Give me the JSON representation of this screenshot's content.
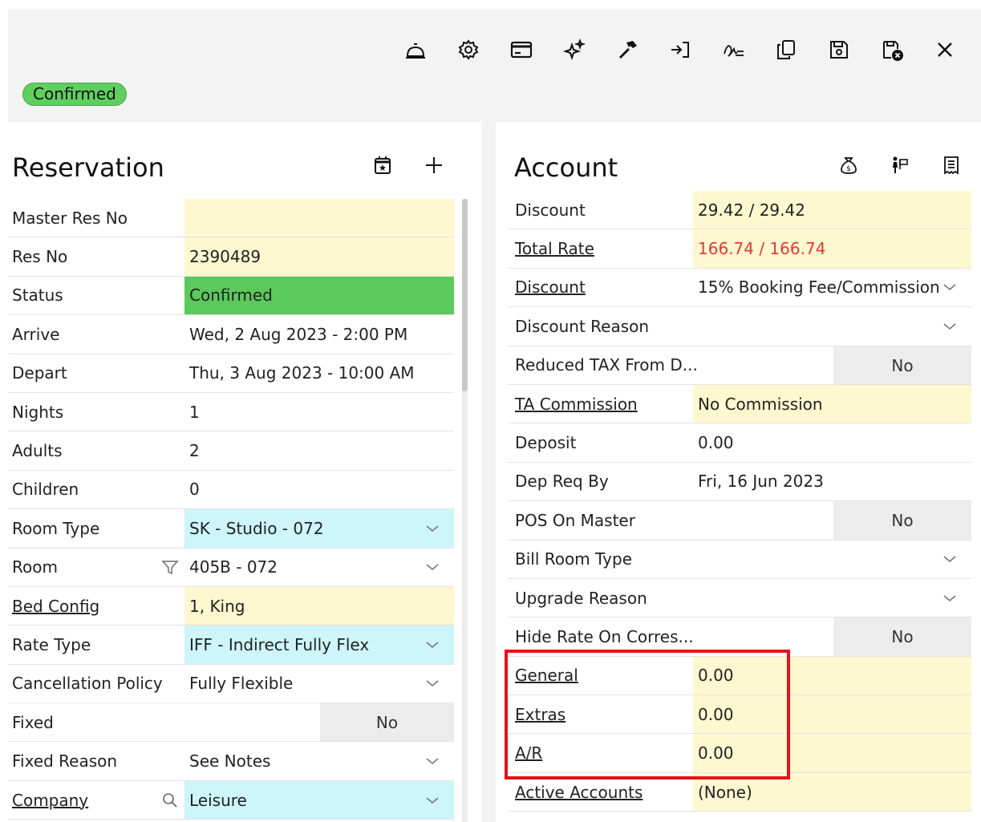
{
  "status_badge": "Confirmed",
  "toolbar_icons": [
    "bell-icon",
    "gear-icon",
    "card-icon",
    "sparkle-icon",
    "hammer-icon",
    "check-in-icon",
    "signature-icon",
    "copy-icon",
    "save-icon",
    "save-close-icon",
    "close-icon"
  ],
  "reservation": {
    "title": "Reservation",
    "actions": [
      "calendar-icon",
      "plus-icon"
    ],
    "rows": [
      {
        "label": "Master Res No",
        "value": ""
      },
      {
        "label": "Res No",
        "value": "2390489"
      },
      {
        "label": "Status",
        "value": "Confirmed"
      },
      {
        "label": "Arrive",
        "value": "Wed, 2 Aug 2023 - 2:00 PM"
      },
      {
        "label": "Depart",
        "value": "Thu, 3 Aug 2023 - 10:00 AM"
      },
      {
        "label": "Nights",
        "value": "1"
      },
      {
        "label": "Adults",
        "value": "2"
      },
      {
        "label": "Children",
        "value": "0"
      },
      {
        "label": "Room Type",
        "value": "SK - Studio - 072"
      },
      {
        "label": "Room",
        "value": "405B - 072"
      },
      {
        "label": "Bed Config",
        "value": "1, King"
      },
      {
        "label": "Rate Type",
        "value": "IFF - Indirect Fully Flex"
      },
      {
        "label": "Cancellation Policy",
        "value": "Fully Flexible"
      },
      {
        "label": "Fixed",
        "value": "No"
      },
      {
        "label": "Fixed Reason",
        "value": "See Notes"
      },
      {
        "label": "Company",
        "value": "Leisure"
      }
    ]
  },
  "account": {
    "title": "Account",
    "actions": [
      "money-bag-icon",
      "person-sign-icon",
      "receipt-icon"
    ],
    "rows": [
      {
        "label": "Discount",
        "value": "29.42 / 29.42"
      },
      {
        "label": "Total Rate",
        "value": "166.74 / 166.74"
      },
      {
        "label": "Discount",
        "value": "15% Booking Fee/Commission"
      },
      {
        "label": "Discount Reason",
        "value": ""
      },
      {
        "label": "Reduced TAX From D...",
        "value": "No"
      },
      {
        "label": "TA Commission",
        "value": "No Commission"
      },
      {
        "label": "Deposit",
        "value": "0.00"
      },
      {
        "label": "Dep Req By",
        "value": "Fri, 16 Jun 2023"
      },
      {
        "label": "POS On Master",
        "value": "No"
      },
      {
        "label": "Bill Room Type",
        "value": ""
      },
      {
        "label": "Upgrade Reason",
        "value": ""
      },
      {
        "label": "Hide Rate On Corres...",
        "value": "No"
      },
      {
        "label": "General",
        "value": "0.00"
      },
      {
        "label": "Extras",
        "value": "0.00"
      },
      {
        "label": "A/R",
        "value": "0.00"
      },
      {
        "label": "Active Accounts",
        "value": "(None)"
      }
    ]
  },
  "colors": {
    "confirmed_green": "#5bc95b",
    "field_yellow": "#fdf8d0",
    "field_cyan": "#cdf5fa",
    "rate_red": "#e53935",
    "highlight_red": "#e0141a"
  }
}
